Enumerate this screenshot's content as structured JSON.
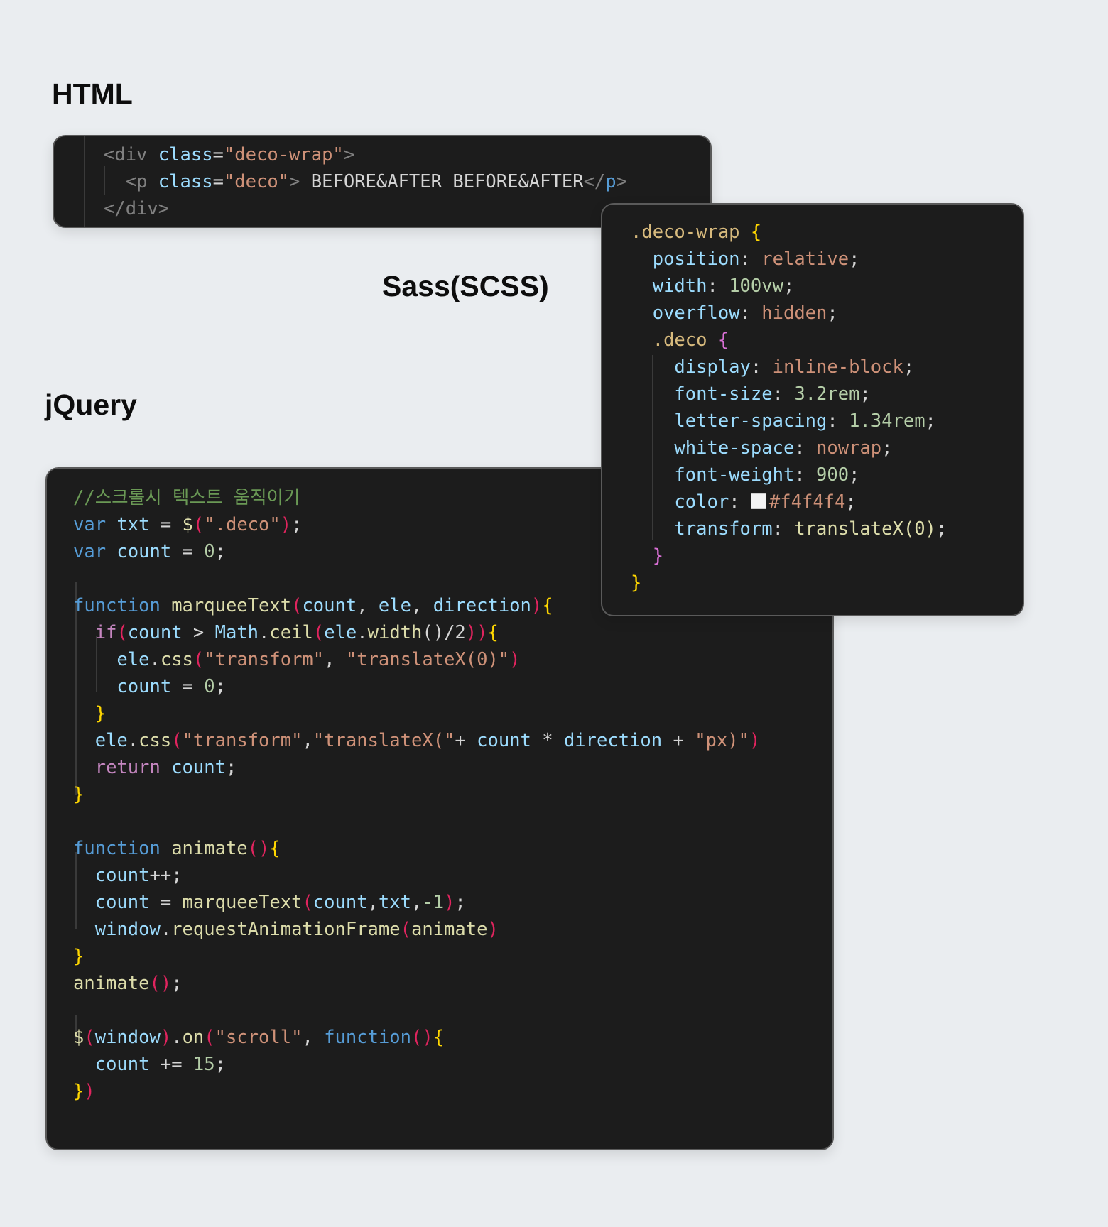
{
  "headings": {
    "html": "HTML",
    "scss": "Sass(SCSS)",
    "jquery": "jQuery"
  },
  "html_code": {
    "line1": {
      "open": "<div",
      "attr": "class",
      "eq": "=",
      "value": "\"deco-wrap\"",
      "close": ">"
    },
    "line2": {
      "open": "<p",
      "attr": "class",
      "eq": "=",
      "value": "\"deco\"",
      "close": ">",
      "text": " BEFORE&AFTER BEFORE&AFTER",
      "end_open": "</",
      "end_name": "p",
      "end_close": ">"
    },
    "line3": {
      "close_tag": "</div>"
    }
  },
  "scss_code": {
    "sel_wrap": ".deco-wrap",
    "brace_open": "{",
    "brace_close": "}",
    "wrap_props": [
      {
        "prop": "position",
        "value": "relative"
      },
      {
        "prop": "width",
        "value": "100vw"
      },
      {
        "prop": "overflow",
        "value": "hidden"
      }
    ],
    "sel_deco": ".deco",
    "deco_props": [
      {
        "prop": "display",
        "value": "inline-block"
      },
      {
        "prop": "font-size",
        "value": "3.2rem"
      },
      {
        "prop": "letter-spacing",
        "value": "1.34rem"
      },
      {
        "prop": "white-space",
        "value": "nowrap"
      },
      {
        "prop": "font-weight",
        "value": "900"
      },
      {
        "prop": "color",
        "value": "#f4f4f4"
      },
      {
        "prop": "transform",
        "value": "translateX(0)"
      }
    ]
  },
  "jquery_code": {
    "comment": "//스크롤시 텍스트 움직이기",
    "var_kw": "var",
    "txt": "txt",
    "count": "count",
    "dollar": "$",
    "deco_str": "\".deco\"",
    "zero": "0",
    "function_kw": "function",
    "marquee_fn": "marqueeText",
    "ele": "ele",
    "direction": "direction",
    "if_kw": "if",
    "math": "Math",
    "ceil": "ceil",
    "width": "width",
    "css": "css",
    "transform_str": "\"transform\"",
    "translate0_str": "\"translateX(0)\"",
    "translate_open_str": "\"translateX(\"",
    "px_str": "\"px)\"",
    "return_kw": "return",
    "animate_fn": "animate",
    "window": "window",
    "raf": "requestAnimationFrame",
    "neg_one": "-1",
    "on": "on",
    "scroll_str": "\"scroll\"",
    "fifteen": "15"
  }
}
